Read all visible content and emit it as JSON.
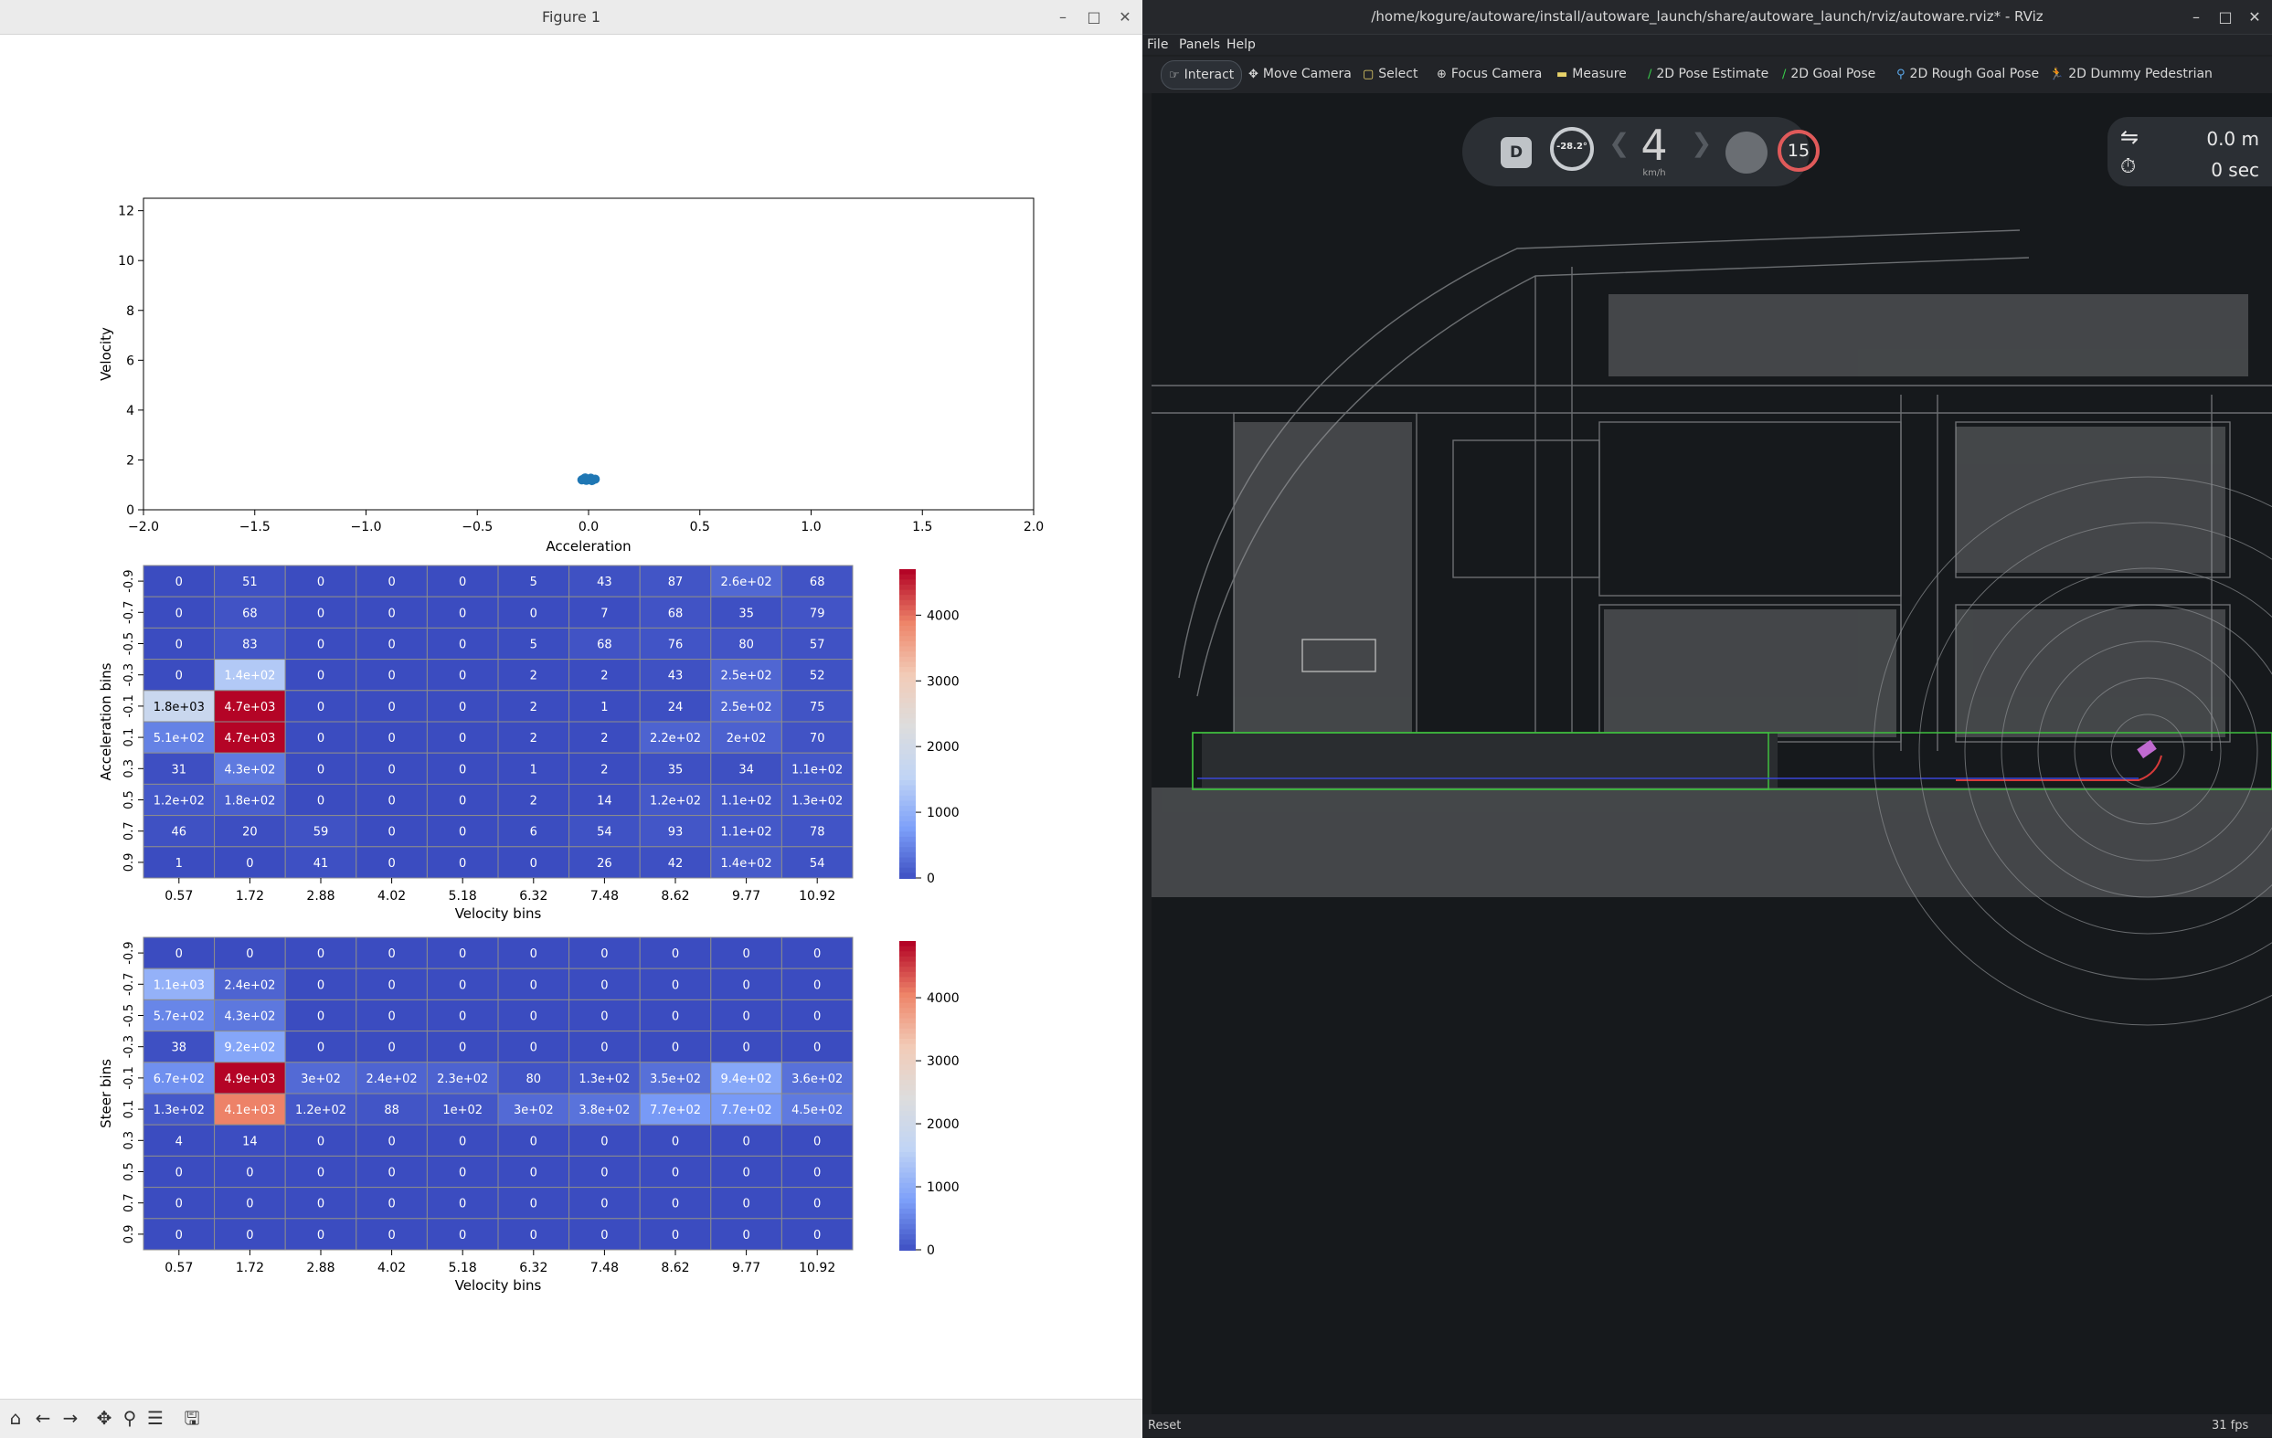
{
  "figure": {
    "window_title": "Figure 1",
    "scatter": {
      "xlabel": "Acceleration",
      "ylabel": "Velocity",
      "xticks": [
        "−2.0",
        "−1.5",
        "−1.0",
        "−0.5",
        "0.0",
        "0.5",
        "1.0",
        "1.5",
        "2.0"
      ],
      "yticks": [
        "0",
        "2",
        "4",
        "6",
        "8",
        "10",
        "12"
      ]
    },
    "toolbar": [
      "home-icon",
      "back-icon",
      "forward-icon",
      "pan-icon",
      "zoom-icon",
      "configure-icon",
      "save-icon"
    ]
  },
  "chart_data": [
    {
      "type": "scatter",
      "xlabel": "Acceleration",
      "ylabel": "Velocity",
      "xlim": [
        -2.0,
        2.0
      ],
      "ylim": [
        0,
        12.5
      ],
      "color": "#1f77b4",
      "points": [
        {
          "x": -0.03,
          "y": 1.2
        },
        {
          "x": -0.02,
          "y": 1.25
        },
        {
          "x": -0.01,
          "y": 1.18
        },
        {
          "x": 0.0,
          "y": 1.22
        },
        {
          "x": 0.01,
          "y": 1.27
        },
        {
          "x": 0.02,
          "y": 1.2
        },
        {
          "x": 0.03,
          "y": 1.23
        },
        {
          "x": -0.015,
          "y": 1.28
        },
        {
          "x": 0.015,
          "y": 1.17
        }
      ]
    },
    {
      "type": "heatmap",
      "xlabel": "Velocity bins",
      "ylabel": "Acceleration bins",
      "x_ticks": [
        "0.57",
        "1.72",
        "2.88",
        "4.02",
        "5.18",
        "6.32",
        "7.48",
        "8.62",
        "9.77",
        "10.92"
      ],
      "y_ticks": [
        "-0.9",
        "-0.7",
        "-0.5",
        "-0.3",
        "-0.1",
        "0.1",
        "0.3",
        "0.5",
        "0.7",
        "0.9"
      ],
      "colorbar_ticks": [
        "0",
        "1000",
        "2000",
        "3000",
        "4000"
      ],
      "vmax": 4700,
      "values": [
        [
          0,
          51,
          0,
          0,
          0,
          5,
          43,
          87,
          260,
          68
        ],
        [
          0,
          68,
          0,
          0,
          0,
          0,
          7,
          68,
          35,
          79
        ],
        [
          0,
          83,
          0,
          0,
          0,
          5,
          68,
          76,
          80,
          57
        ],
        [
          0,
          1400,
          0,
          0,
          0,
          2,
          2,
          43,
          250,
          52
        ],
        [
          1800,
          4700,
          0,
          0,
          0,
          2,
          1,
          24,
          250,
          75
        ],
        [
          510,
          4700,
          0,
          0,
          0,
          2,
          2,
          220,
          200,
          70
        ],
        [
          31,
          430,
          0,
          0,
          0,
          1,
          2,
          35,
          34,
          110
        ],
        [
          120,
          180,
          0,
          0,
          0,
          2,
          14,
          120,
          110,
          130
        ],
        [
          46,
          20,
          59,
          0,
          0,
          6,
          54,
          93,
          110,
          78
        ],
        [
          1,
          0,
          41,
          0,
          0,
          0,
          26,
          42,
          140,
          54
        ]
      ],
      "labels": [
        [
          "0",
          "51",
          "0",
          "0",
          "0",
          "5",
          "43",
          "87",
          "2.6e+02",
          "68"
        ],
        [
          "0",
          "68",
          "0",
          "0",
          "0",
          "0",
          "7",
          "68",
          "35",
          "79"
        ],
        [
          "0",
          "83",
          "0",
          "0",
          "0",
          "5",
          "68",
          "76",
          "80",
          "57"
        ],
        [
          "0",
          "1.4e+02",
          "0",
          "0",
          "0",
          "2",
          "2",
          "43",
          "2.5e+02",
          "52"
        ],
        [
          "1.8e+03",
          "4.7e+03",
          "0",
          "0",
          "0",
          "2",
          "1",
          "24",
          "2.5e+02",
          "75"
        ],
        [
          "5.1e+02",
          "4.7e+03",
          "0",
          "0",
          "0",
          "2",
          "2",
          "2.2e+02",
          "2e+02",
          "70"
        ],
        [
          "31",
          "4.3e+02",
          "0",
          "0",
          "0",
          "1",
          "2",
          "35",
          "34",
          "1.1e+02"
        ],
        [
          "1.2e+02",
          "1.8e+02",
          "0",
          "0",
          "0",
          "2",
          "14",
          "1.2e+02",
          "1.1e+02",
          "1.3e+02"
        ],
        [
          "46",
          "20",
          "59",
          "0",
          "0",
          "6",
          "54",
          "93",
          "1.1e+02",
          "78"
        ],
        [
          "1",
          "0",
          "41",
          "0",
          "0",
          "0",
          "26",
          "42",
          "1.4e+02",
          "54"
        ]
      ]
    },
    {
      "type": "heatmap",
      "xlabel": "Velocity bins",
      "ylabel": "Steer bins",
      "x_ticks": [
        "0.57",
        "1.72",
        "2.88",
        "4.02",
        "5.18",
        "6.32",
        "7.48",
        "8.62",
        "9.77",
        "10.92"
      ],
      "y_ticks": [
        "-0.9",
        "-0.7",
        "-0.5",
        "-0.3",
        "-0.1",
        "0.1",
        "0.3",
        "0.5",
        "0.7",
        "0.9"
      ],
      "colorbar_ticks": [
        "0",
        "1000",
        "2000",
        "3000",
        "4000"
      ],
      "vmax": 4900,
      "values": [
        [
          0,
          0,
          0,
          0,
          0,
          0,
          0,
          0,
          0,
          0
        ],
        [
          1100,
          240,
          0,
          0,
          0,
          0,
          0,
          0,
          0,
          0
        ],
        [
          570,
          430,
          0,
          0,
          0,
          0,
          0,
          0,
          0,
          0
        ],
        [
          38,
          920,
          0,
          0,
          0,
          0,
          0,
          0,
          0,
          0
        ],
        [
          670,
          4900,
          300,
          240,
          230,
          80,
          130,
          350,
          940,
          360
        ],
        [
          130,
          4100,
          120,
          88,
          100,
          300,
          380,
          770,
          770,
          450
        ],
        [
          4,
          14,
          0,
          0,
          0,
          0,
          0,
          0,
          0,
          0
        ],
        [
          0,
          0,
          0,
          0,
          0,
          0,
          0,
          0,
          0,
          0
        ],
        [
          0,
          0,
          0,
          0,
          0,
          0,
          0,
          0,
          0,
          0
        ],
        [
          0,
          0,
          0,
          0,
          0,
          0,
          0,
          0,
          0,
          0
        ]
      ],
      "labels": [
        [
          "0",
          "0",
          "0",
          "0",
          "0",
          "0",
          "0",
          "0",
          "0",
          "0"
        ],
        [
          "1.1e+03",
          "2.4e+02",
          "0",
          "0",
          "0",
          "0",
          "0",
          "0",
          "0",
          "0"
        ],
        [
          "5.7e+02",
          "4.3e+02",
          "0",
          "0",
          "0",
          "0",
          "0",
          "0",
          "0",
          "0"
        ],
        [
          "38",
          "9.2e+02",
          "0",
          "0",
          "0",
          "0",
          "0",
          "0",
          "0",
          "0"
        ],
        [
          "6.7e+02",
          "4.9e+03",
          "3e+02",
          "2.4e+02",
          "2.3e+02",
          "80",
          "1.3e+02",
          "3.5e+02",
          "9.4e+02",
          "3.6e+02"
        ],
        [
          "1.3e+02",
          "4.1e+03",
          "1.2e+02",
          "88",
          "1e+02",
          "3e+02",
          "3.8e+02",
          "7.7e+02",
          "7.7e+02",
          "4.5e+02"
        ],
        [
          "4",
          "14",
          "0",
          "0",
          "0",
          "0",
          "0",
          "0",
          "0",
          "0"
        ],
        [
          "0",
          "0",
          "0",
          "0",
          "0",
          "0",
          "0",
          "0",
          "0",
          "0"
        ],
        [
          "0",
          "0",
          "0",
          "0",
          "0",
          "0",
          "0",
          "0",
          "0",
          "0"
        ],
        [
          "0",
          "0",
          "0",
          "0",
          "0",
          "0",
          "0",
          "0",
          "0",
          "0"
        ]
      ]
    }
  ],
  "rviz": {
    "window_title": "/home/kogure/autoware/install/autoware_launch/share/autoware_launch/rviz/autoware.rviz* - RViz",
    "menu": [
      "File",
      "Panels",
      "Help"
    ],
    "tools": [
      {
        "label": "Interact",
        "icon": "pointer-icon",
        "active": true
      },
      {
        "label": "Move Camera",
        "icon": "move-icon",
        "active": false
      },
      {
        "label": "Select",
        "icon": "select-icon",
        "active": false
      },
      {
        "label": "Focus Camera",
        "icon": "focus-icon",
        "active": false
      },
      {
        "label": "Measure",
        "icon": "ruler-icon",
        "active": false
      },
      {
        "label": "2D Pose Estimate",
        "icon": "arrow-green-icon",
        "active": false
      },
      {
        "label": "2D Goal Pose",
        "icon": "arrow-green-icon",
        "active": false
      },
      {
        "label": "2D Rough Goal Pose",
        "icon": "pin-icon",
        "active": false
      },
      {
        "label": "2D Dummy Pedestrian",
        "icon": "pedestrian-icon",
        "active": false
      }
    ],
    "hud": {
      "gear": "D",
      "steering": "-28.2°",
      "speed": "4",
      "speed_unit": "km/h",
      "speed_limit": "15",
      "distance": "0.0 m",
      "time": "0 sec"
    },
    "status": {
      "reset": "Reset",
      "fps": "31 fps"
    }
  }
}
